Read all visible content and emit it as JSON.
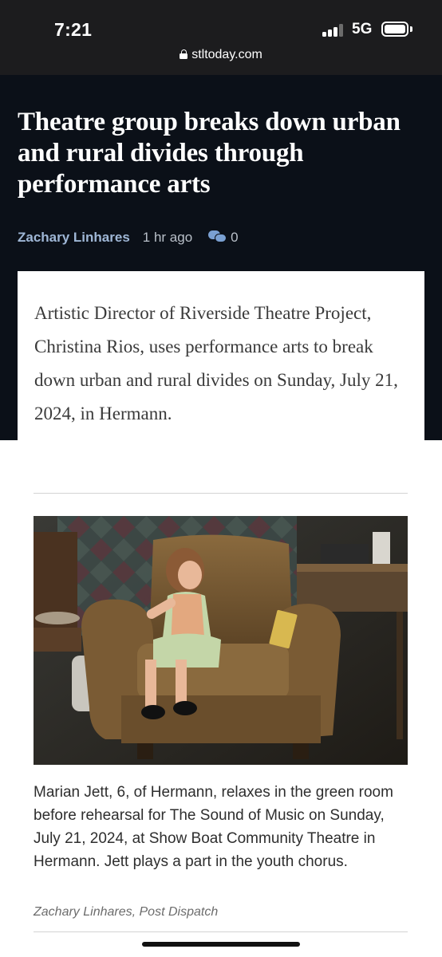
{
  "status_bar": {
    "time": "7:21",
    "network": "5G",
    "url": "stltoday.com"
  },
  "article": {
    "headline": "Theatre group breaks down urban and rural divides through performance arts",
    "author": "Zachary Linhares",
    "time_ago": "1 hr ago",
    "comment_count": "0",
    "summary": "Artistic Director of Riverside Theatre Project, Christina Rios, uses performance arts to break down urban and rural divides on Sunday, July 21, 2024, in Hermann.",
    "photo_caption": "Marian Jett, 6, of Hermann, relaxes in the green room before rehearsal for The Sound of Music on Sunday, July 21, 2024, at Show Boat Community Theatre in Hermann. Jett plays a part in the youth chorus.",
    "photo_credit": "Zachary Linhares, Post Dispatch"
  },
  "icons": {
    "lock": "lock-icon",
    "comments": "comment-icon",
    "signal": "signal-bars-icon",
    "battery": "battery-icon"
  },
  "colors": {
    "header_bg": "#0b1018",
    "author_link": "#9fb7d6",
    "comment_accent": "#7aa0d2"
  }
}
